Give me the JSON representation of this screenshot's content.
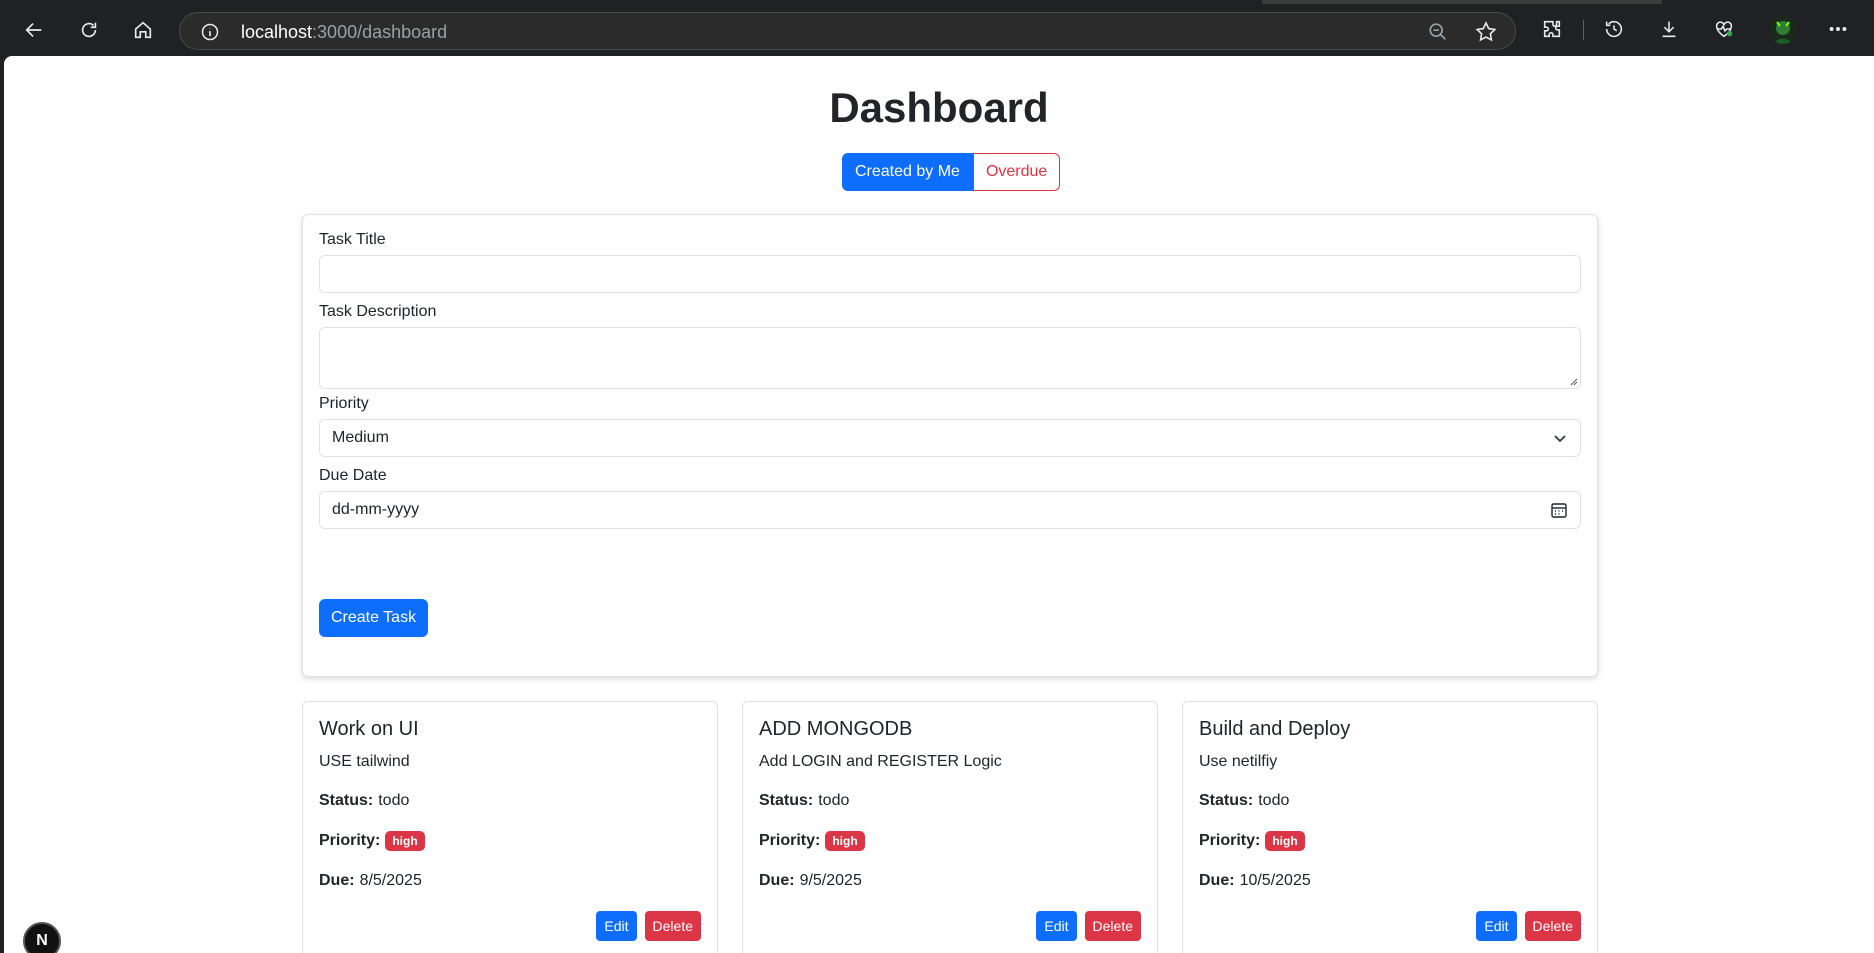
{
  "browser": {
    "url_host": "localhost",
    "url_rest": ":3000/dashboard",
    "icons": [
      "back-icon",
      "reload-icon",
      "home-icon",
      "info-icon",
      "zoom-out-icon",
      "star-icon",
      "extensions-icon",
      "history-icon",
      "download-icon",
      "health-icon",
      "profile-avatar",
      "more-icon"
    ]
  },
  "page": {
    "title": "Dashboard",
    "filters": {
      "created_by_me": "Created by Me",
      "overdue": "Overdue"
    }
  },
  "form": {
    "title_label": "Task Title",
    "title_value": "",
    "description_label": "Task Description",
    "description_value": "",
    "priority_label": "Priority",
    "priority_value": "Medium",
    "due_label": "Due Date",
    "due_placeholder": "dd-mm-yyyy",
    "submit": "Create Task"
  },
  "labels": {
    "status": "Status:",
    "priority": "Priority:",
    "due": "Due:",
    "edit": "Edit",
    "delete": "Delete"
  },
  "tasks": [
    {
      "title": "Work on UI",
      "description": "USE tailwind",
      "status": "todo",
      "priority": "high",
      "due": "8/5/2025"
    },
    {
      "title": "ADD MONGODB",
      "description": "Add LOGIN and REGISTER Logic",
      "status": "todo",
      "priority": "high",
      "due": "9/5/2025"
    },
    {
      "title": "Build and Deploy",
      "description": "Use netilfiy",
      "status": "todo",
      "priority": "high",
      "due": "10/5/2025"
    }
  ],
  "dev_indicator": "N",
  "colors": {
    "primary": "#0d6efd",
    "danger": "#dc3545",
    "text": "#212529",
    "chrome": "#202124"
  }
}
